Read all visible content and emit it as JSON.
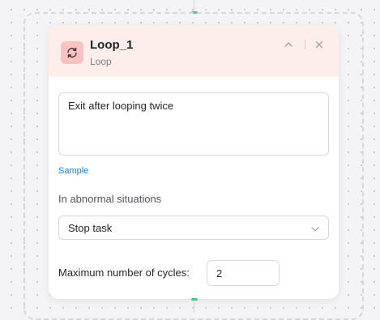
{
  "node": {
    "title": "Loop_1",
    "type_label": "Loop",
    "icon": "loop-arrows-icon",
    "header_color": "#fdeeec",
    "icon_bg_color": "#f7c3c0"
  },
  "header_actions": {
    "collapse_icon": "chevron-up-icon",
    "close_icon": "close-icon"
  },
  "description": {
    "value": "Exit after looping twice"
  },
  "sample_link": "Sample",
  "abnormal": {
    "label": "In abnormal situations",
    "selected": "Stop task"
  },
  "cycles": {
    "label": "Maximum number of cycles:",
    "value": "2"
  },
  "colors": {
    "connector_port": "#3ad07f",
    "link": "#1f7ad6"
  }
}
